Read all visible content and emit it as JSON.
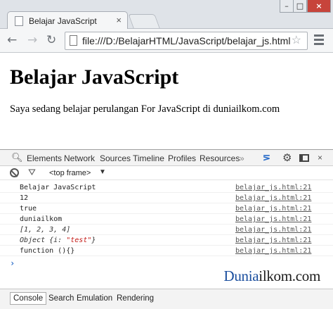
{
  "browser": {
    "tab_title": "Belajar JavaScript",
    "tab_close": "×",
    "url": "file:///D:/BelajarHTML/JavaScript/belajar_js.html",
    "back_icon": "←",
    "forward_icon": "→",
    "reload_icon": "↻",
    "star_icon": "☆",
    "window_min": "–",
    "window_max": "□",
    "window_close": "×"
  },
  "page": {
    "heading": "Belajar JavaScript",
    "paragraph": "Saya sedang belajar perulangan For JavaScript di duniailkom.com"
  },
  "devtools": {
    "tabs": [
      "Elements",
      "Network",
      "Sources",
      "Timeline",
      "Profiles",
      "Resources"
    ],
    "more": "»",
    "close": "×",
    "frame": "<top frame>",
    "frame_arrow": "▼",
    "console": [
      {
        "text": "Belajar JavaScript",
        "source": "belajar_js.html:21"
      },
      {
        "text": "12",
        "source": "belajar_js.html:21"
      },
      {
        "text": "true",
        "source": "belajar_js.html:21"
      },
      {
        "text": "duniailkom",
        "source": "belajar_js.html:21"
      },
      {
        "text": "[1, 2, 3, 4]",
        "source": "belajar_js.html:21"
      },
      {
        "text_prefix": "Object {i: ",
        "text_string": "\"test\"",
        "text_suffix": "}",
        "source": "belajar_js.html:21"
      },
      {
        "text": "function (){}",
        "source": "belajar_js.html:21"
      }
    ],
    "prompt": "›",
    "drawer_tabs": [
      "Console",
      "Search",
      "Emulation",
      "Rendering"
    ]
  },
  "watermark": {
    "part1": "Dunia",
    "part2": "ilkom.com"
  },
  "colors": {
    "accent": "#2a6dc9",
    "string": "#c41a16",
    "window_close": "#c7443b"
  }
}
